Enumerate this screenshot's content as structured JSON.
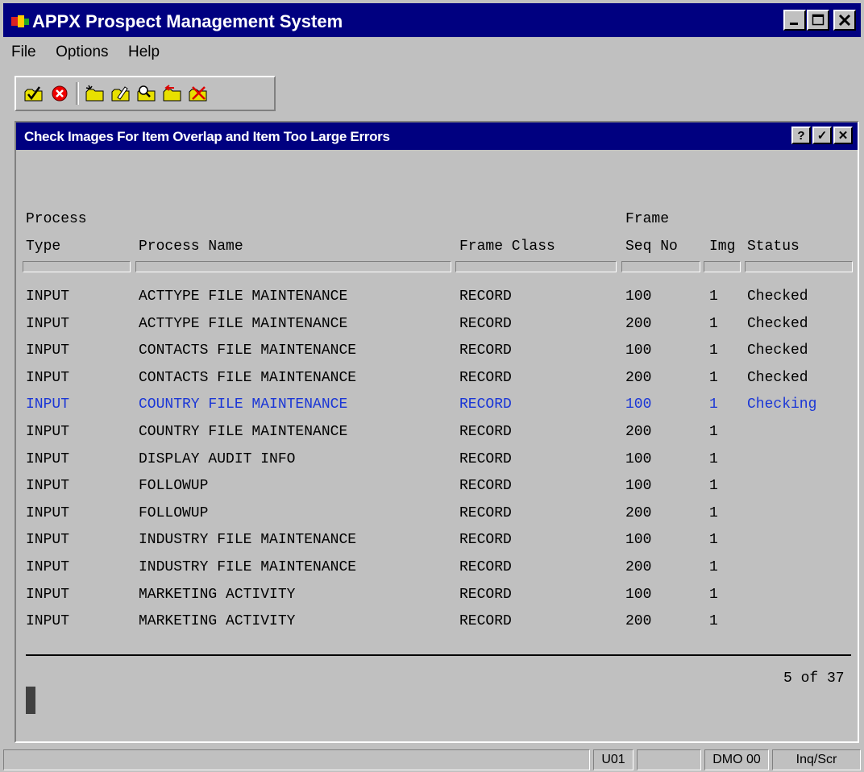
{
  "window": {
    "title": "APPX Prospect Management System"
  },
  "menu": {
    "items": [
      "File",
      "Options",
      "Help"
    ]
  },
  "toolbar": {
    "icons": [
      "check-folder-icon",
      "cancel-icon",
      "new-folder-icon",
      "edit-folder-icon",
      "search-folder-icon",
      "back-folder-icon",
      "delete-folder-icon"
    ]
  },
  "dialog": {
    "title": "Check Images For Item Overlap and Item Too Large Errors",
    "buttons": {
      "help": "?",
      "ok": "✓",
      "close": "✕"
    }
  },
  "table": {
    "headers": {
      "process_top": "Process",
      "type": "Type",
      "process_name": "Process Name",
      "frame_class": "Frame Class",
      "frame_top": "Frame",
      "seq_no": "Seq No",
      "img": "Img",
      "status": "Status"
    },
    "rows": [
      {
        "type": "INPUT",
        "name": "ACTTYPE FILE MAINTENANCE",
        "frame_class": "RECORD",
        "seq": "100",
        "img": "1",
        "status": "Checked",
        "highlight": false
      },
      {
        "type": "INPUT",
        "name": "ACTTYPE FILE MAINTENANCE",
        "frame_class": "RECORD",
        "seq": "200",
        "img": "1",
        "status": "Checked",
        "highlight": false
      },
      {
        "type": "INPUT",
        "name": "CONTACTS FILE MAINTENANCE",
        "frame_class": "RECORD",
        "seq": "100",
        "img": "1",
        "status": "Checked",
        "highlight": false
      },
      {
        "type": "INPUT",
        "name": "CONTACTS FILE MAINTENANCE",
        "frame_class": "RECORD",
        "seq": "200",
        "img": "1",
        "status": "Checked",
        "highlight": false
      },
      {
        "type": "INPUT",
        "name": "COUNTRY FILE MAINTENANCE",
        "frame_class": "RECORD",
        "seq": "100",
        "img": "1",
        "status": "Checking",
        "highlight": true
      },
      {
        "type": "INPUT",
        "name": "COUNTRY FILE MAINTENANCE",
        "frame_class": "RECORD",
        "seq": "200",
        "img": "1",
        "status": "",
        "highlight": false
      },
      {
        "type": "INPUT",
        "name": "DISPLAY AUDIT INFO",
        "frame_class": "RECORD",
        "seq": "100",
        "img": "1",
        "status": "",
        "highlight": false
      },
      {
        "type": "INPUT",
        "name": "FOLLOWUP",
        "frame_class": "RECORD",
        "seq": "100",
        "img": "1",
        "status": "",
        "highlight": false
      },
      {
        "type": "INPUT",
        "name": "FOLLOWUP",
        "frame_class": "RECORD",
        "seq": "200",
        "img": "1",
        "status": "",
        "highlight": false
      },
      {
        "type": "INPUT",
        "name": "INDUSTRY FILE MAINTENANCE",
        "frame_class": "RECORD",
        "seq": "100",
        "img": "1",
        "status": "",
        "highlight": false
      },
      {
        "type": "INPUT",
        "name": "INDUSTRY FILE MAINTENANCE",
        "frame_class": "RECORD",
        "seq": "200",
        "img": "1",
        "status": "",
        "highlight": false
      },
      {
        "type": "INPUT",
        "name": "MARKETING ACTIVITY",
        "frame_class": "RECORD",
        "seq": "100",
        "img": "1",
        "status": "",
        "highlight": false
      },
      {
        "type": "INPUT",
        "name": "MARKETING ACTIVITY",
        "frame_class": "RECORD",
        "seq": "200",
        "img": "1",
        "status": "",
        "highlight": false
      }
    ],
    "page_indicator": "5 of 37"
  },
  "colors": {
    "titlebar": "#000080",
    "highlight_text": "#1a36d6",
    "face": "#c0c0c0"
  },
  "statusbar": {
    "user": "U01",
    "empty": "",
    "db": "DMO 00",
    "mode": "Inq/Scr"
  }
}
